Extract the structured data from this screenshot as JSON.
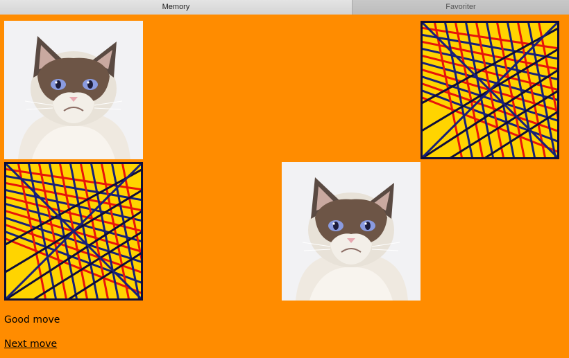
{
  "tabs": [
    {
      "label": "Memory",
      "active": true
    },
    {
      "label": "Favoriter",
      "active": false
    }
  ],
  "colors": {
    "background": "#ff8c00"
  },
  "board": {
    "columns": 4,
    "rows": 2,
    "cards": [
      {
        "row": 0,
        "col": 0,
        "state": "face-up",
        "image": "grumpy-cat-photo"
      },
      {
        "row": 0,
        "col": 1,
        "state": "removed"
      },
      {
        "row": 0,
        "col": 2,
        "state": "removed"
      },
      {
        "row": 0,
        "col": 3,
        "state": "face-down",
        "image": "card-back-pattern"
      },
      {
        "row": 1,
        "col": 0,
        "state": "face-down",
        "image": "card-back-pattern"
      },
      {
        "row": 1,
        "col": 1,
        "state": "removed"
      },
      {
        "row": 1,
        "col": 2,
        "state": "face-up",
        "image": "grumpy-cat-photo"
      },
      {
        "row": 1,
        "col": 3,
        "state": "removed"
      }
    ]
  },
  "status": "Good move",
  "next_move_label": "Next move"
}
